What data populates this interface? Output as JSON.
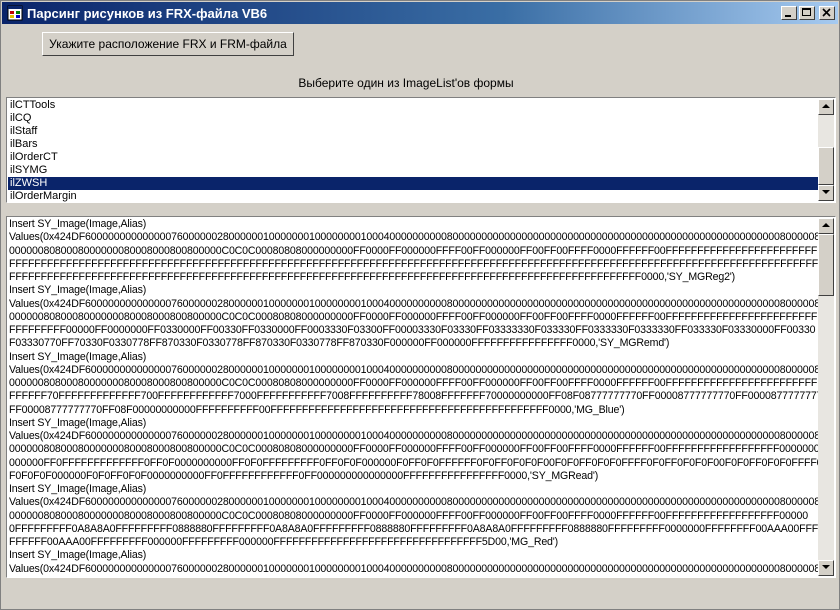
{
  "window": {
    "title": "Парсинг рисунков из FRX-файла VB6"
  },
  "locate_button": {
    "label": "Укажите расположение FRX и FRM-файла"
  },
  "imagelist_caption": "Выберите один из ImageList'ов формы",
  "imagelists": {
    "items": [
      "ilCTTools",
      "ilCQ",
      "ilStaff",
      "ilBars",
      "ilOrderCT",
      "ilSYMG",
      "ilZWSH",
      "ilOrderMargin"
    ],
    "selected": "ilZWSH"
  },
  "output": {
    "lines": [
      "Insert SY_Image(Image,Alias)",
      "Values(0x424DF6000000000000007600000028000000100000001000000001000400000000008000000000000000000000000000000000000000000000000000000000800000800000",
      "0000008080008000000080008000800800000C0C0C00080808000000000FF0000FF000000FFFF00FF000000FF00FF00FFFF0000FFFFFF00FFFFFFFFFFFFFFFFFFFFFFFF",
      "FFFFFFFFFFFFFFFFFFFFFFFFFFFFFFFFFFFFFFFFFFFFFFFFFFFFFFFFFFFFFFFFFFFFFFFFFFFFFFFFFFFFFFFFFFFFFFFFFFFFFFFFFFFFFFFFFFFFFFFFFFFFFFFFFFFFFFFFFFFFF",
      "FFFFFFFFFFFFFFFFFFFFFFFFFFFFFFFFFFFFFFFFFFFFFFFFFFFFFFFFFFFFFFFFFFFFFFFFFFFFFFFFFFFFFFFFFFFFFFFFFFFF0000,'SY_MGReg2')",
      "Insert SY_Image(Image,Alias)",
      "Values(0x424DF6000000000000007600000028000000100000001000000001000400000000008000000000000000000000000000000000000000000000000000000000800000800000",
      "0000008080008000000080008000800800000C0C0C00080808000000000FF0000FF000000FFFF00FF000000FF00FF00FFFF0000FFFFFF00FFFFFFFFFFFFFFFFFFFFFFFF",
      "FFFFFFFFF00000FF0000000FF0330000FF00330FF0330000FF0003330F03300FF00003330F03330FF03333330F033330FF0333330F0333330FF033330F03330000FF00330",
      "F03330770FF70330F0330778FF870330F0330778FF870330F0330778FF870330F000000FF000000FFFFFFFFFFFFFFFF0000,'SY_MGRemd')",
      "Insert SY_Image(Image,Alias)",
      "Values(0x424DF6000000000000007600000028000000100000001000000001000400000000008000000000000000000000000000000000000000000000000000000000800000800000",
      "0000008080008000000080008000800800000C0C0C00080808000000000FF0000FF000000FFFF00FF000000FF00FF00FFFF0000FFFFFF00FFFFFFFFFFFFFFFFFFFFFFFF",
      "FFFFFF70FFFFFFFFFFFFF700FFFFFFFFFFFF7000FFFFFFFFFFF7008FFFFFFFFFF78008FFFFFFF70000000000FF08F08777777770FF00008777777770FF00008777777770",
      "FF00008777777770FF08F00000000000FFFFFFFFFF00FFFFFFFFFFFFFFFFFFFFFFFFFFFFFFFFFFFFFFFFFFFF0000,'MG_Blue')",
      "Insert SY_Image(Image,Alias)",
      "Values(0x424DF6000000000000007600000028000000100000001000000001000400000000008000000000000000000000000000000000000000000000000000000000800000800000",
      "0000008080008000000080008000800800000C0C0C00080808000000000FF0000FF000000FFFF00FF000000FF00FF00FFFF0000FFFFFF00FFFFFFFFFFFFFFFFFF00000000",
      "000000FF0FFFFFFFFFFFFF0FF0F0000000000FF0F0FFFFFFFFF0FF0F0F000000F0FF0F0FFFFFF0F0FF0F0F0F00F0F0FF0F0F0FFFF0F0FF0F0F0F00F0F0FF0F0F0FFFF0F0F",
      "F0F0F0F000000F0F0FF0F0F0000000000FF0FFFFFFFFFFFF0FF000000000000000FFFFFFFFFFFFFFFF0000,'SY_MGRead')",
      "Insert SY_Image(Image,Alias)",
      "Values(0x424DF6000000000000007600000028000000100000001000000001000400000000008000000000000000000000000000000000000000000000000000000000800000800000",
      "0000008080008000000080008000800800000C0C0C00080808000000000FF0000FF000000FFFF00FF000000FF00FF00FFFF0000FFFFFF00FFFFFFFFFFFFFFFFFF00000",
      "0FFFFFFFFF0A8A8A0FFFFFFFFF0888880FFFFFFFFF0A8A8A0FFFFFFFFF0888880FFFFFFFFF0A8A8A0FFFFFFFFF0888880FFFFFFFFF0000000FFFFFFFF00AAA00FFFFFF",
      "FFFFFF00AAA00FFFFFFFFF000000FFFFFFFFF000000FFFFFFFFFFFFFFFFFFFFFFFFFFFFFFFFF5D00,'MG_Red')",
      "Insert SY_Image(Image,Alias)",
      "Values(0x424DF6000000000000007600000028000000100000001000000001000400000000008000000000000000000000000000000000000000000000000000000000800000800000"
    ]
  },
  "scrollbars": {
    "list_position": 1.0,
    "text_position": 0.0
  },
  "colors": {
    "title_start": "#0a246a",
    "title_end": "#a6caf0",
    "selection": "#0a246a",
    "face": "#d4d0c8"
  }
}
